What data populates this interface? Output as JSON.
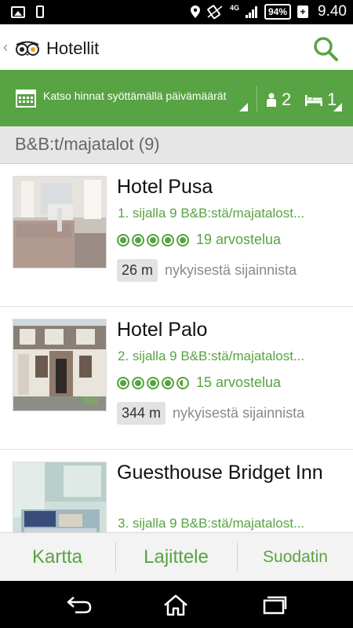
{
  "status_bar": {
    "network": "4G",
    "battery": "94%",
    "battery_plus": "+",
    "time": "9.40"
  },
  "app_bar": {
    "back_glyph": "‹",
    "title": "Hotellit",
    "logo_icon": "tripadvisor-owl-icon",
    "search_icon": "search-icon"
  },
  "filter_bar": {
    "date_prompt": "Katso hinnat syöttämällä päivämäärät",
    "guests": "2",
    "rooms": "1",
    "colors": {
      "accent": "#58a343"
    }
  },
  "section": {
    "header": "B&B:t/majatalot (9)"
  },
  "hotels": [
    {
      "name": "Hotel Pusa",
      "rank": "1. sijalla 9 B&B:stä/majatalost...",
      "rating": 5,
      "reviews": "19 arvostelua",
      "distance": "26 m",
      "distance_text": "nykyisestä sijainnista"
    },
    {
      "name": "Hotel Palo",
      "rank": "2. sijalla 9 B&B:stä/majatalost...",
      "rating": 4.5,
      "reviews": "15 arvostelua",
      "distance": "344 m",
      "distance_text": "nykyisestä sijainnista"
    },
    {
      "name": "Guesthouse Bridget Inn",
      "rank": "3. sijalla 9 B&B:stä/majatalost...",
      "rating": null,
      "reviews": "",
      "distance": "",
      "distance_text": ""
    }
  ],
  "toolbar": {
    "map": "Kartta",
    "sort": "Lajittele",
    "filter": "Suodatin"
  },
  "nav": {
    "back_icon": "back-icon",
    "home_icon": "home-icon",
    "recents_icon": "recents-icon"
  }
}
